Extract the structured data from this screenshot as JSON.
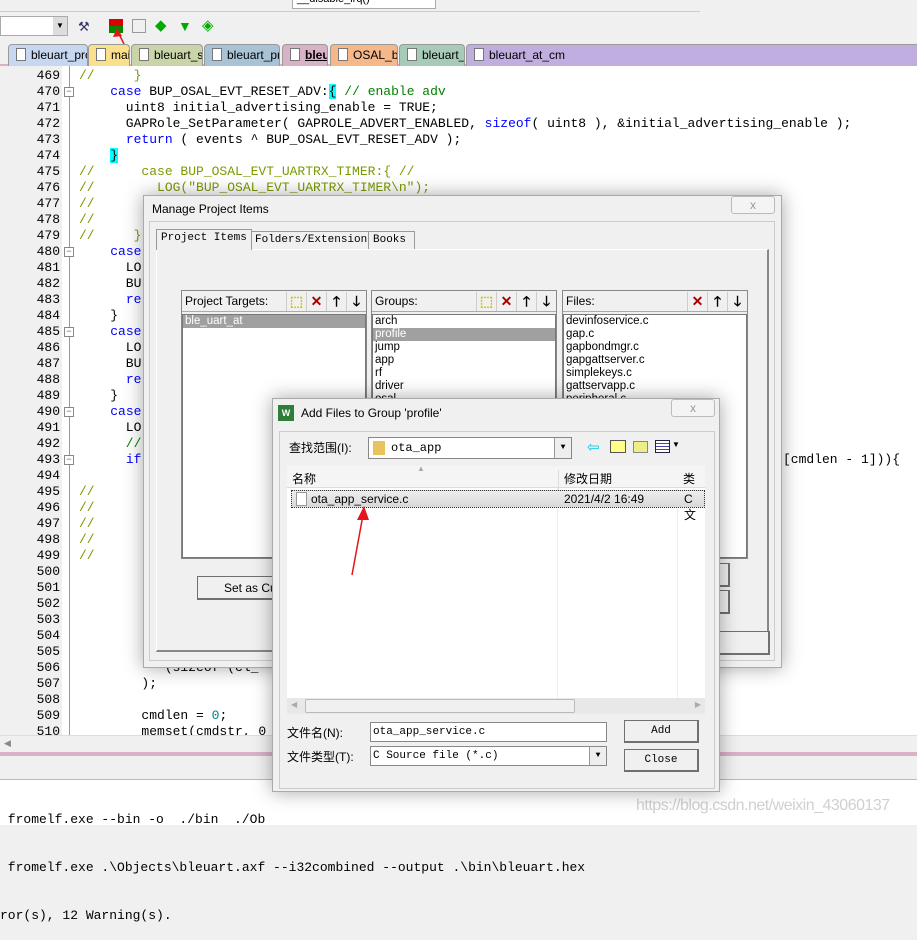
{
  "toolbar": {
    "function_combo": "__disable_irq()",
    "target_combo": ""
  },
  "tabs": [
    {
      "label": "bleuart_protocol.h",
      "color": "#c6d7ef"
    },
    {
      "label": "main.c",
      "color": "#fbe08c"
    },
    {
      "label": "bleuart_service.c",
      "color": "#c9d4a8"
    },
    {
      "label": "bleuart_protocol.c",
      "color": "#a8c3d6"
    },
    {
      "label": "bleuart.c",
      "color": "#d8b2c6",
      "active": true
    },
    {
      "label": "OSAL_bleuart.c",
      "color": "#f5b88a"
    },
    {
      "label": "bleuart_Main.c",
      "color": "#a8cbb8"
    },
    {
      "label": "bleuart_at_cm",
      "color": "#c0aee0"
    }
  ],
  "editor": {
    "lines": [
      {
        "n": "469",
        "seg": [
          [
            "//     }",
            "cs"
          ]
        ]
      },
      {
        "n": "470",
        "fold": true,
        "seg": [
          [
            "    ",
            ""
          ],
          [
            "case",
            "kw"
          ],
          [
            " BUP_OSAL_EVT_RESET_ADV:",
            ""
          ],
          [
            "{",
            "hl"
          ],
          [
            " // enable adv",
            "cm"
          ]
        ]
      },
      {
        "n": "471",
        "seg": [
          [
            "      uint8 initial_advertising_enable = TRUE;",
            ""
          ]
        ]
      },
      {
        "n": "472",
        "seg": [
          [
            "      GAPRole_SetParameter( GAPROLE_ADVERT_ENABLED, ",
            ""
          ],
          [
            "sizeof",
            "kw"
          ],
          [
            "( uint8 ), &initial_advertising_enable );",
            ""
          ]
        ]
      },
      {
        "n": "473",
        "seg": [
          [
            "      ",
            ""
          ],
          [
            "return",
            "kw"
          ],
          [
            " ( events ^ BUP_OSAL_EVT_RESET_ADV );",
            ""
          ]
        ]
      },
      {
        "n": "474",
        "seg": [
          [
            "    ",
            ""
          ],
          [
            "}",
            "hl"
          ]
        ]
      },
      {
        "n": "475",
        "seg": [
          [
            "//      case BUP_OSAL_EVT_UARTRX_TIMER:{ //",
            "cs"
          ]
        ]
      },
      {
        "n": "476",
        "seg": [
          [
            "//        LOG(\"BUP_OSAL_EVT_UARTRX_TIMER\\n\");",
            "cs"
          ]
        ]
      },
      {
        "n": "477",
        "seg": [
          [
            "//        B",
            "cs"
          ]
        ]
      },
      {
        "n": "478",
        "seg": [
          [
            "//        r",
            "cs"
          ]
        ]
      },
      {
        "n": "479",
        "seg": [
          [
            "//     }",
            "cs"
          ]
        ]
      },
      {
        "n": "480",
        "fold": true,
        "seg": [
          [
            "    ",
            ""
          ],
          [
            "case",
            "kw"
          ]
        ]
      },
      {
        "n": "481",
        "seg": [
          [
            "      LO",
            ""
          ]
        ]
      },
      {
        "n": "482",
        "seg": [
          [
            "      BU",
            ""
          ]
        ]
      },
      {
        "n": "483",
        "seg": [
          [
            "      ",
            ""
          ],
          [
            "re",
            "kw"
          ]
        ]
      },
      {
        "n": "484",
        "seg": [
          [
            "    }",
            ""
          ]
        ]
      },
      {
        "n": "485",
        "fold": true,
        "seg": [
          [
            "    ",
            ""
          ],
          [
            "case",
            "kw"
          ]
        ]
      },
      {
        "n": "486",
        "seg": [
          [
            "      LO",
            ""
          ]
        ]
      },
      {
        "n": "487",
        "seg": [
          [
            "      BU",
            ""
          ]
        ]
      },
      {
        "n": "488",
        "seg": [
          [
            "      ",
            ""
          ],
          [
            "re",
            "kw"
          ]
        ]
      },
      {
        "n": "489",
        "seg": [
          [
            "    }",
            ""
          ]
        ]
      },
      {
        "n": "490",
        "fold": true,
        "seg": [
          [
            "    ",
            ""
          ],
          [
            "case",
            "kw"
          ]
        ]
      },
      {
        "n": "491",
        "seg": [
          [
            "      LO",
            ""
          ]
        ]
      },
      {
        "n": "492",
        "seg": [
          [
            "      //",
            "cm"
          ]
        ]
      },
      {
        "n": "493",
        "fold": true,
        "seg": [
          [
            "      ",
            ""
          ],
          [
            "if",
            "kw"
          ]
        ],
        "tail": "[cmdlen - 1])){"
      },
      {
        "n": "494",
        "seg": []
      },
      {
        "n": "495",
        "seg": [
          [
            "//",
            "cs"
          ]
        ]
      },
      {
        "n": "496",
        "seg": [
          [
            "//",
            "cs"
          ]
        ]
      },
      {
        "n": "497",
        "seg": [
          [
            "//",
            "cs"
          ]
        ]
      },
      {
        "n": "498",
        "seg": [
          [
            "//",
            "cs"
          ]
        ]
      },
      {
        "n": "499",
        "seg": [
          [
            "//",
            "cs"
          ]
        ]
      },
      {
        "n": "500",
        "seg": []
      },
      {
        "n": "501",
        "seg": []
      },
      {
        "n": "502",
        "seg": []
      },
      {
        "n": "503",
        "seg": []
      },
      {
        "n": "504",
        "seg": []
      },
      {
        "n": "505",
        "seg": []
      },
      {
        "n": "506",
        "seg": [
          [
            "           (sizeof (cl_",
            ""
          ]
        ]
      },
      {
        "n": "507",
        "seg": [
          [
            "        );",
            ""
          ]
        ]
      },
      {
        "n": "508",
        "seg": []
      },
      {
        "n": "509",
        "seg": [
          [
            "        cmdlen = ",
            ""
          ],
          [
            "0",
            "num"
          ],
          [
            ";",
            ""
          ]
        ]
      },
      {
        "n": "510",
        "seg": [
          [
            "        memset(cmdstr, 0",
            ""
          ]
        ]
      }
    ]
  },
  "output": {
    "lines": [
      " fromelf.exe --bin -o  ./bin  ./Ob",
      " fromelf.exe .\\Objects\\bleuart.axf --i32combined --output .\\bin\\bleuart.hex",
      "ror(s), 12 Warning(s)."
    ]
  },
  "watermark": "https://blog.csdn.net/weixin_43060137",
  "manage_dialog": {
    "title": "Manage Project Items",
    "close": "x",
    "tabs": [
      "Project Items",
      "Folders/Extensions",
      "Books"
    ],
    "targets": {
      "label": "Project Targets:",
      "items": [
        "ble_uart_at"
      ],
      "selected": 0
    },
    "groups": {
      "label": "Groups:",
      "items": [
        "arch",
        "profile",
        "jump",
        "app",
        "rf",
        "driver",
        "osal"
      ],
      "selected": 1
    },
    "files": {
      "label": "Files:",
      "items": [
        "devinfoservice.c",
        "gap.c",
        "gapbondmgr.c",
        "gapgattserver.c",
        "simplekeys.c",
        "gattservapp.c",
        "peripheral.c"
      ]
    },
    "set_current_button": "Set as Cur",
    "help_button": "lp"
  },
  "add_dialog": {
    "title": "Add Files to Group 'profile'",
    "close": "x",
    "look_in_label": "查找范围(I):",
    "look_in_value": "ota_app",
    "columns": [
      "名称",
      "修改日期",
      "类型"
    ],
    "files": [
      {
        "name": "ota_app_service.c",
        "date": "2021/4/2 16:49",
        "type": "C 文"
      }
    ],
    "filename_label": "文件名(N):",
    "filename_value": "ota_app_service.c",
    "filetype_label": "文件类型(T):",
    "filetype_value": "C Source file (*.c)",
    "add_button": "Add",
    "close_button": "Close"
  },
  "annotation_color": "#e8141c"
}
